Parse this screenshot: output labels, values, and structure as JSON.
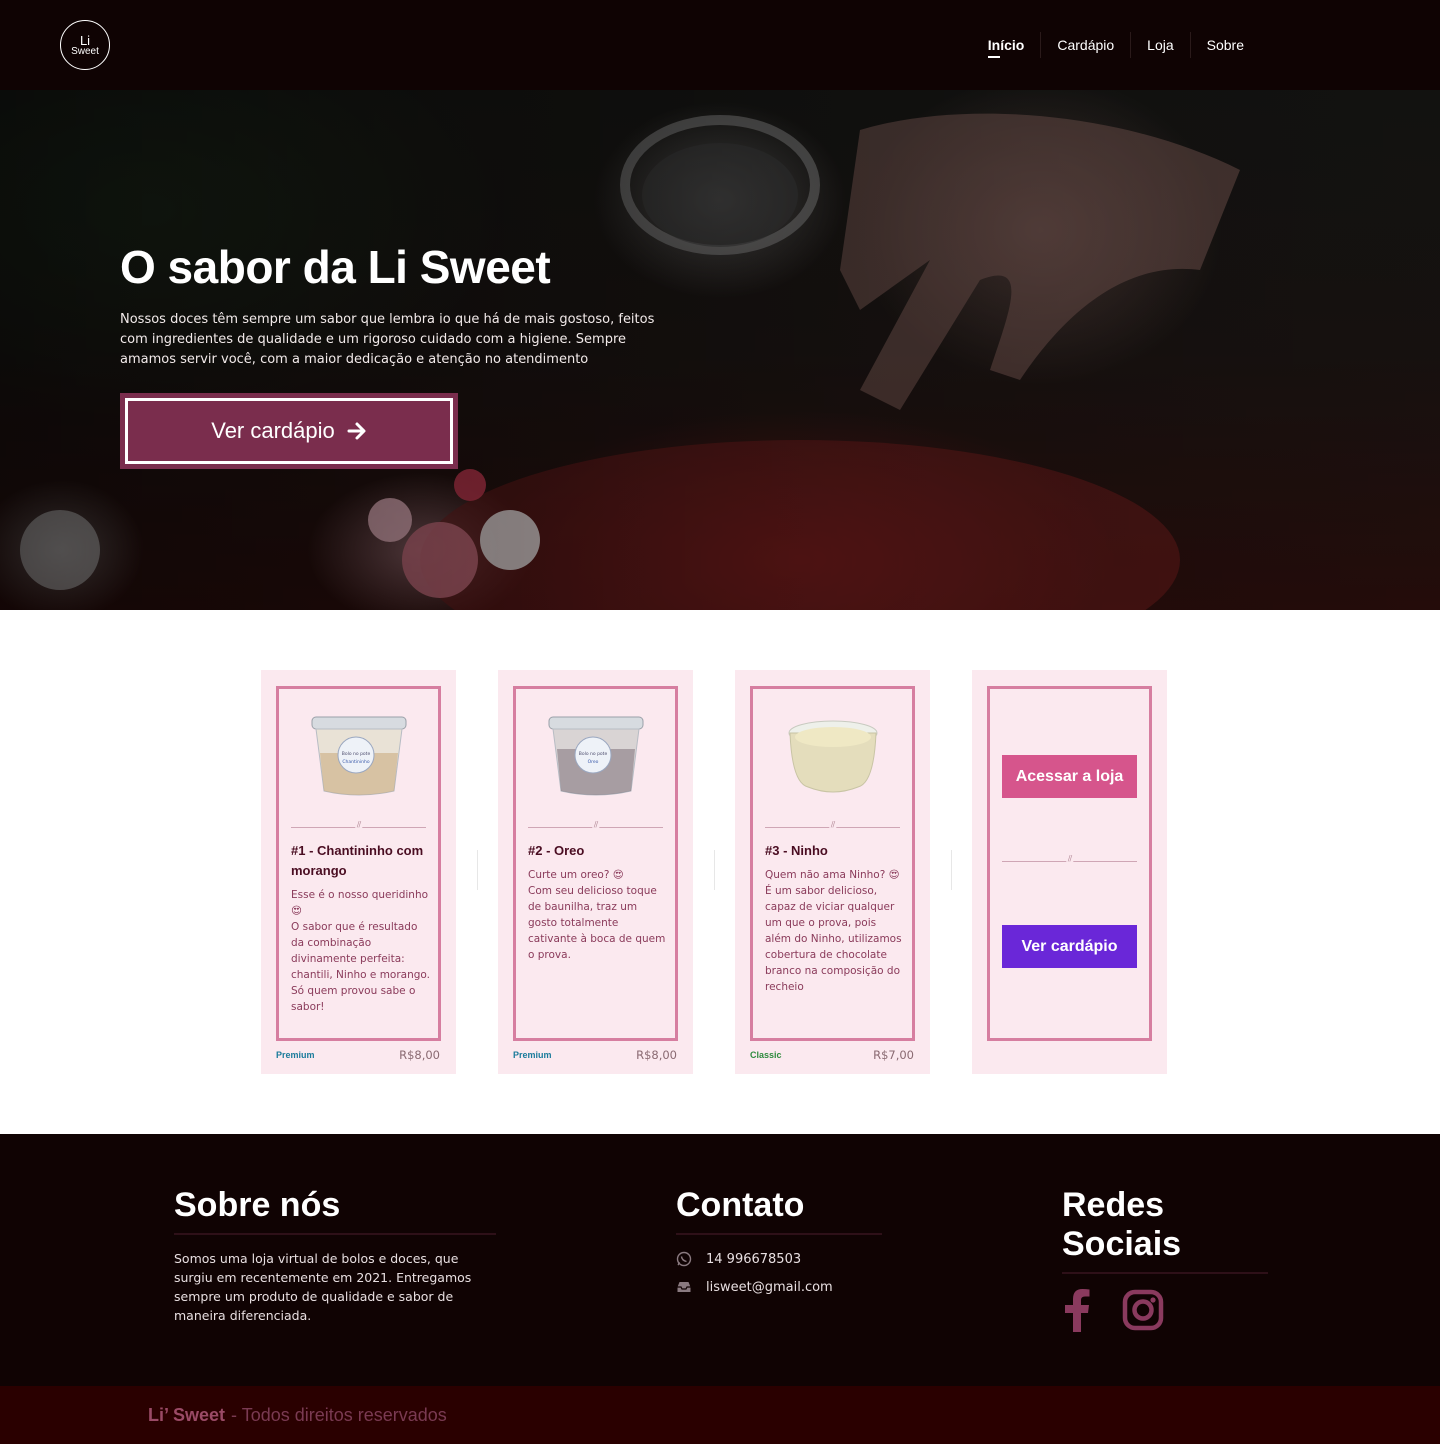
{
  "header": {
    "logo_line1": "Li",
    "logo_line2": "Sweet",
    "nav": [
      {
        "label": "Início",
        "active": true
      },
      {
        "label": "Cardápio",
        "active": false
      },
      {
        "label": "Loja",
        "active": false
      },
      {
        "label": "Sobre",
        "active": false
      }
    ]
  },
  "hero": {
    "title": "O sabor da Li Sweet",
    "text": "Nossos doces têm sempre um sabor que lembra io que há de mais gostoso, feitos com ingredientes de qualidade e um rigoroso cuidado com a higiene. Sempre amamos servir você, com a maior dedicação e atenção no atendimento",
    "button_label": "Ver cardápio",
    "button_icon": "arrow-right-icon"
  },
  "products": [
    {
      "title": "#1 - Chantininho com morango",
      "description": "Esse é o nosso queridinho 😍\nO sabor que é resultado da combinação divinamente perfeita: chantili, Ninho e morango. Só quem provou sabe o sabor!",
      "tag": "Premium",
      "tag_color": "#1a7b9b",
      "price": "R$8,00",
      "label_line1": "Bolo no pote",
      "label_line2": "Chantininho"
    },
    {
      "title": "#2 - Oreo",
      "description": "Curte um oreo? 😍\nCom seu delicioso toque de baunilha, traz um gosto totalmente cativante à boca de quem o prova.",
      "tag": "Premium",
      "tag_color": "#1a7b9b",
      "price": "R$8,00",
      "label_line1": "Bolo no pote",
      "label_line2": "Oreo"
    },
    {
      "title": "#3 - Ninho",
      "description": "Quem não ama Ninho? 😍\nÉ um sabor delicioso, capaz de viciar qualquer um que o prova, pois além do Ninho, utilizamos cobertura de chocolate branco na composição do recheio",
      "tag": "Classic",
      "tag_color": "#2e8b3e",
      "price": "R$7,00"
    }
  ],
  "cta": {
    "shop_label": "Acessar a loja",
    "shop_color": "#d6558c",
    "menu_label": "Ver cardápio",
    "menu_color": "#6a27d8"
  },
  "footer": {
    "about_title": "Sobre nós",
    "about_text": "Somos uma loja virtual de bolos e doces, que surgiu em recentemente em 2021. Entregamos sempre um produto de qualidade e sabor de maneira diferenciada.",
    "contact_title": "Contato",
    "phone": "14 996678503",
    "email": "lisweet@gmail.com",
    "social_title": "Redes Sociais",
    "social_icons": [
      "facebook-icon",
      "instagram-icon"
    ],
    "social_color": "#8a3a5e",
    "bottom_brand": "Li’ Sweet",
    "bottom_rest": "- Todos direitos reservados"
  }
}
